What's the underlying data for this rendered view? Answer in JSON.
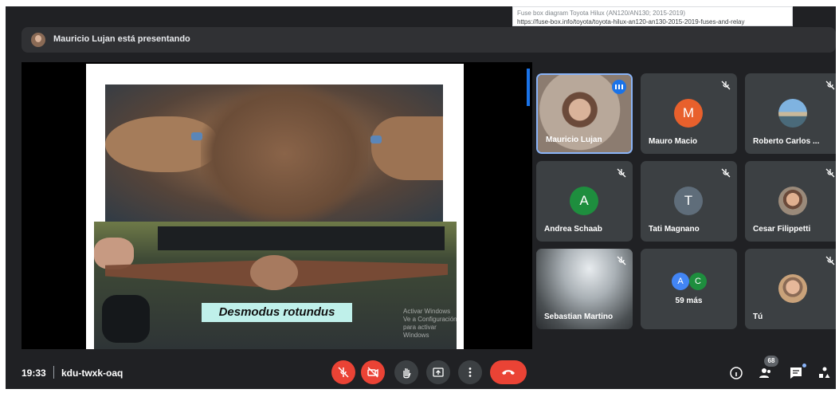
{
  "tooltip": {
    "line1": "Fuse box diagram Toyota Hilux (AN120/AN130; 2015-2019)",
    "line2": "https://fuse-box.info/toyota/toyota-hilux-an120-an130-2015-2019-fuses-and-relay"
  },
  "presentation_bar": {
    "text": "Mauricio Lujan está presentando"
  },
  "slide": {
    "caption": "Desmodus rotundus",
    "watermark_line1": "Activar Windows",
    "watermark_line2": "Ve a Configuración para activar Windows"
  },
  "participants": [
    {
      "name": "Mauricio Lujan",
      "type": "video",
      "speaking": true
    },
    {
      "name": "Mauro Macio",
      "initial": "M",
      "color": "#e8602c",
      "muted": true
    },
    {
      "name": "Roberto Carlos ...",
      "type": "photo",
      "muted": true
    },
    {
      "name": "Andrea Schaab",
      "initial": "A",
      "color": "#1e8e3e",
      "muted": true
    },
    {
      "name": "Tati Magnano",
      "initial": "T",
      "color": "#5f6d7a",
      "muted": true
    },
    {
      "name": "Cesar Filippetti",
      "type": "photo",
      "muted": true
    },
    {
      "name": "Sebastian Martino",
      "type": "video",
      "muted": true
    },
    {
      "more_label": "59 más",
      "initials": [
        "A",
        "C"
      ],
      "colors": [
        "#4285f4",
        "#1e8e3e"
      ]
    },
    {
      "name": "Tú",
      "type": "photo",
      "muted": true
    }
  ],
  "controls": {
    "time": "19:33",
    "meeting_code": "kdu-twxk-oaq",
    "participants_badge": "68",
    "icons": [
      "mic-off-icon",
      "camera-off-icon",
      "raise-hand-icon",
      "present-icon",
      "more-options-icon",
      "end-call-icon",
      "info-icon",
      "people-icon",
      "chat-icon",
      "activities-icon"
    ]
  },
  "colors": {
    "background": "#202124",
    "tile": "#3c4043",
    "danger": "#ea4335",
    "accent": "#8ab4f8"
  }
}
